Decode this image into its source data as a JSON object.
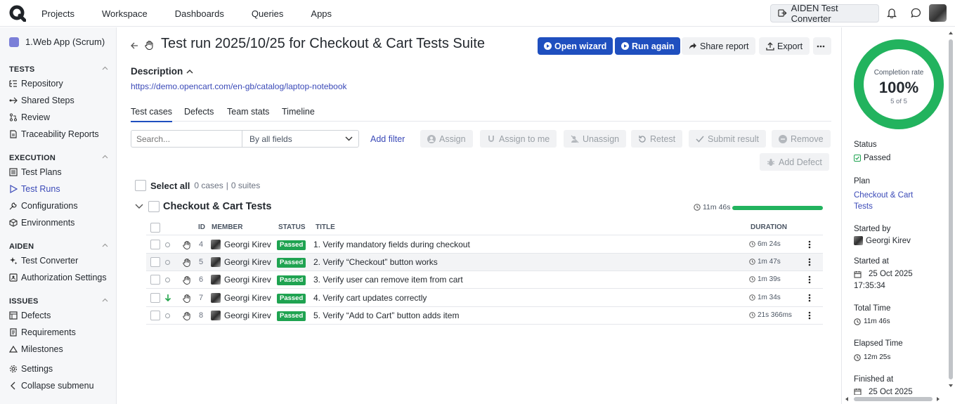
{
  "topbar": {
    "nav": [
      "Projects",
      "Workspace",
      "Dashboards",
      "Queries",
      "Apps"
    ],
    "aiden_button": "AIDEN Test Converter"
  },
  "sidebar": {
    "project": "1.Web App (Scrum)",
    "sections": [
      {
        "title": "TESTS",
        "items": [
          "Repository",
          "Shared Steps",
          "Review",
          "Traceability Reports"
        ]
      },
      {
        "title": "EXECUTION",
        "items": [
          "Test Plans",
          "Test Runs",
          "Configurations",
          "Environments"
        ]
      },
      {
        "title": "AIDEN",
        "items": [
          "Test Converter",
          "Authorization Settings"
        ]
      },
      {
        "title": "ISSUES",
        "items": [
          "Defects",
          "Requirements",
          "Milestones"
        ]
      }
    ],
    "settings": "Settings",
    "collapse": "Collapse submenu"
  },
  "header": {
    "title": "Test run 2025/10/25 for Checkout & Cart Tests Suite",
    "buttons": {
      "open_wizard": "Open wizard",
      "run_again": "Run again",
      "share_report": "Share report",
      "export": "Export"
    }
  },
  "description": {
    "label": "Description",
    "link": "https://demo.opencart.com/en-gb/catalog/laptop-notebook"
  },
  "tabs": [
    "Test cases",
    "Defects",
    "Team stats",
    "Timeline"
  ],
  "toolbar": {
    "search_placeholder": "Search...",
    "field_select": "By all fields",
    "add_filter": "Add filter",
    "assign": "Assign",
    "assign_to_me": "Assign to me",
    "unassign": "Unassign",
    "retest": "Retest",
    "submit_result": "Submit result",
    "remove": "Remove",
    "add_defect": "Add Defect"
  },
  "selection": {
    "label": "Select all",
    "cases": "0 cases",
    "suites": "0 suites"
  },
  "suite": {
    "name": "Checkout & Cart Tests",
    "time": "11m 46s",
    "progress": 1.0
  },
  "table": {
    "headers": {
      "id": "ID",
      "member": "MEMBER",
      "status": "STATUS",
      "title": "TITLE",
      "duration": "DURATION"
    },
    "rows": [
      {
        "id": "4",
        "member": "Georgi Kirev",
        "status": "Passed",
        "title": "1. Verify mandatory fields during checkout",
        "duration": "6m 24s",
        "marker": "circle"
      },
      {
        "id": "5",
        "member": "Georgi Kirev",
        "status": "Passed",
        "title": "2. Verify “Checkout” button works",
        "duration": "1m 47s",
        "marker": "circle"
      },
      {
        "id": "6",
        "member": "Georgi Kirev",
        "status": "Passed",
        "title": "3. Verify user can remove item from cart",
        "duration": "1m 39s",
        "marker": "circle"
      },
      {
        "id": "7",
        "member": "Georgi Kirev",
        "status": "Passed",
        "title": "4. Verify cart updates correctly",
        "duration": "1m 34s",
        "marker": "arrow-down"
      },
      {
        "id": "8",
        "member": "Georgi Kirev",
        "status": "Passed",
        "title": "5. Verify “Add to Cart” button adds item",
        "duration": "21s 366ms",
        "marker": "circle"
      }
    ]
  },
  "panel": {
    "completion_label": "Completion rate",
    "completion_value": "100%",
    "completion_count": "5 of 5",
    "completion_fraction": 1.0,
    "status_label": "Status",
    "status_value": "Passed",
    "plan_label": "Plan",
    "plan_value": "Checkout & Cart Tests",
    "started_by_label": "Started by",
    "started_by_value": "Georgi Kirev",
    "started_at_label": "Started at",
    "started_at_date": "25 Oct 2025",
    "started_at_time": "17:35:34",
    "total_time_label": "Total Time",
    "total_time_value": "11m 46s",
    "elapsed_label": "Elapsed Time",
    "elapsed_value": "12m 25s",
    "finished_label": "Finished at",
    "finished_date": "25 Oct 2025"
  },
  "colors": {
    "accent": "#1f4fbf",
    "passed": "#1fa351",
    "ring": "#22b35e"
  }
}
